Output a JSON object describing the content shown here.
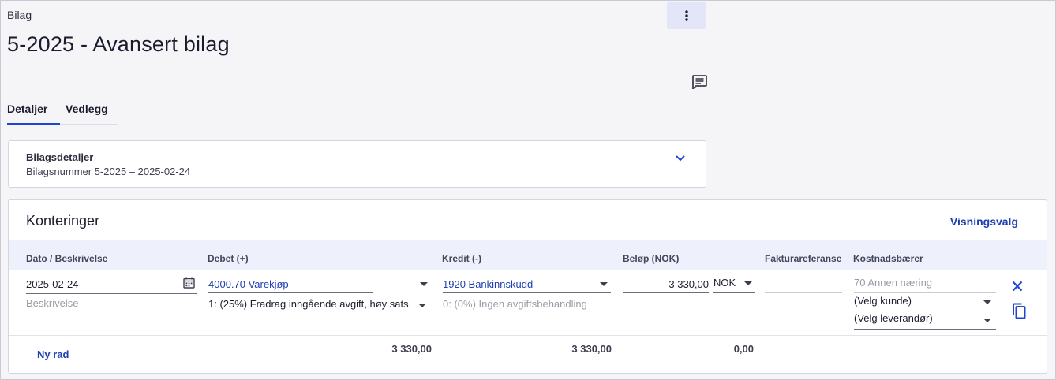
{
  "header": {
    "breadcrumb": "Bilag",
    "title": "5-2025 - Avansert bilag"
  },
  "tabs": [
    {
      "label": "Detaljer",
      "active": true
    },
    {
      "label": "Vedlegg",
      "active": false
    }
  ],
  "details": {
    "heading": "Bilagsdetaljer",
    "summary": "Bilagsnummer 5-2025  –  2025-02-24"
  },
  "postings": {
    "title": "Konteringer",
    "view_options_label": "Visningsvalg",
    "columns": [
      "Dato / Beskrivelse",
      "Debet (+)",
      "Kredit (-)",
      "Beløp (NOK)",
      "Fakturareferanse",
      "Kostnadsbærer"
    ],
    "row": {
      "date": "2025-02-24",
      "description_placeholder": "Beskrivelse",
      "debit_account": "4000.70 Varekjøp",
      "debit_vat": "1: (25%) Fradrag inngående avgift, høy sats",
      "credit_account": "1920 Bankinnskudd",
      "credit_vat": "0: (0%) Ingen avgiftsbehandling",
      "amount": "3 330,00",
      "currency": "NOK",
      "invoice_ref": "",
      "cost_carrier": "70 Annen næring",
      "customer_select": "(Velg kunde)",
      "supplier_select": "(Velg leverandør)"
    },
    "totals": {
      "debit": "3 330,00",
      "credit": "3 330,00",
      "difference": "0,00"
    },
    "new_row_label": "Ny rad"
  },
  "colors": {
    "accent": "#1e46d2",
    "link": "#1e3fb0",
    "table_header_bg": "#eef1fb",
    "page_bg": "#f5f5f8"
  },
  "icons": [
    "more-vertical-icon",
    "comment-icon",
    "chevron-down-icon",
    "calendar-icon",
    "close-icon",
    "copy-icon"
  ]
}
